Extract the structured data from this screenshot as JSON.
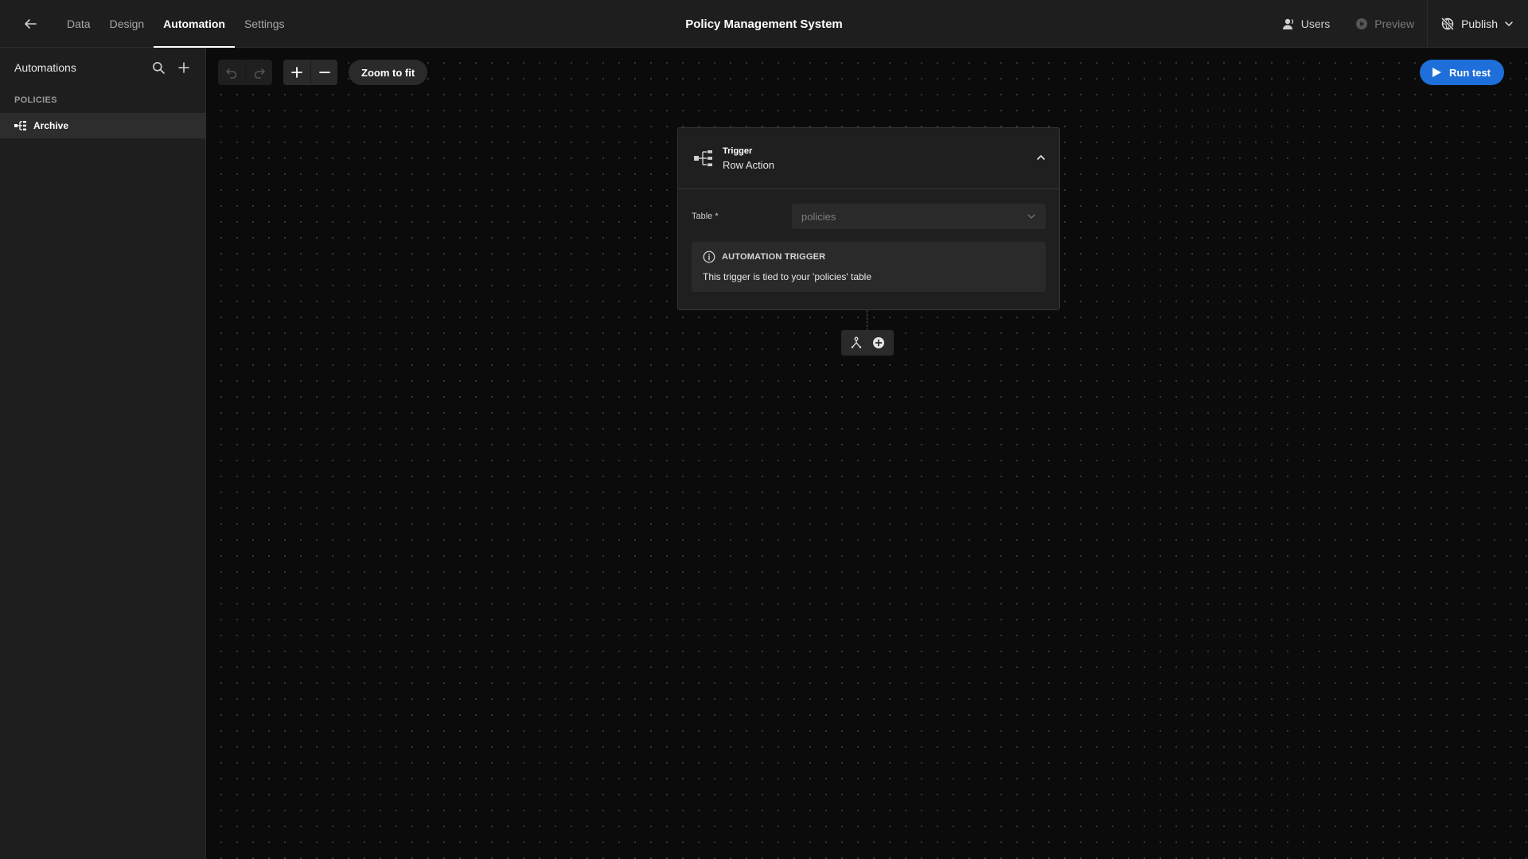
{
  "topbar": {
    "tabs": [
      {
        "label": "Data"
      },
      {
        "label": "Design"
      },
      {
        "label": "Automation"
      },
      {
        "label": "Settings"
      }
    ],
    "title": "Policy Management System",
    "actions": {
      "users": "Users",
      "preview": "Preview",
      "publish": "Publish"
    }
  },
  "sidebar": {
    "title": "Automations",
    "section": "POLICIES",
    "items": [
      {
        "label": "Archive"
      }
    ]
  },
  "canvas": {
    "zoom_fit": "Zoom to fit",
    "run_test": "Run test",
    "card": {
      "kicker": "Trigger",
      "title": "Row Action",
      "field_label": "Table *",
      "field_value": "policies",
      "info_title": "AUTOMATION TRIGGER",
      "info_body": "This trigger is tied to your 'policies' table"
    }
  },
  "colors": {
    "accent": "#1e6fd9",
    "background": "#0b0b0b",
    "panel": "#1e1e1e"
  },
  "icons": [
    "back-arrow-icon",
    "user-icon",
    "play-circle-icon",
    "publish-icon",
    "chevron-down-icon",
    "search-icon",
    "plus-icon",
    "automation-icon",
    "undo-icon",
    "redo-icon",
    "zoom-in-icon",
    "zoom-out-icon",
    "play-icon",
    "chevron-up-icon",
    "info-icon",
    "branch-icon",
    "add-circle-icon"
  ]
}
